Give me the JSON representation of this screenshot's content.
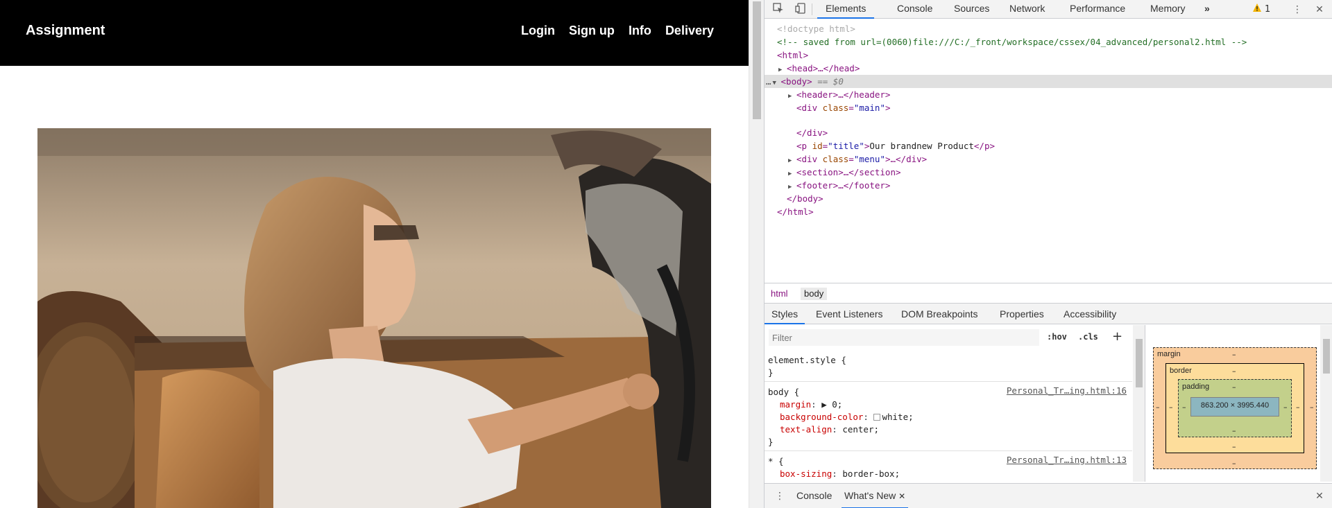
{
  "site": {
    "logo": "Assignment",
    "nav": [
      "Login",
      "Sign up",
      "Info",
      "Delivery"
    ]
  },
  "devtools": {
    "tabs": [
      "Elements",
      "Console",
      "Sources",
      "Network",
      "Performance",
      "Memory"
    ],
    "more_tabs": "»",
    "warning_count": "1",
    "dom": {
      "doctype": "<!doctype html>",
      "comment": "<!-- saved from url=(0060)file:///C:/_front/workspace/cssex/04_advanced/personal2.html -->",
      "html_open": "<html>",
      "head": "<head>…</head>",
      "body_open": "<body>",
      "body_marker": " == $0",
      "header": "<header>…</header>",
      "div_main_tag": "div",
      "div_main_attr": "class",
      "div_main_val": "\"main\"",
      "div_close": "</div>",
      "p_attr": "id",
      "p_val": "\"title\"",
      "p_text": "Our brandnew Product",
      "menu_attr": "class",
      "menu_val": "\"menu\"",
      "section": "<section>…</section>",
      "footer": "<footer>…</footer>",
      "body_close": "</body>",
      "html_close": "</html>"
    },
    "breadcrumbs": [
      "html",
      "body"
    ],
    "subtabs": [
      "Styles",
      "Event Listeners",
      "DOM Breakpoints",
      "Properties",
      "Accessibility"
    ],
    "filter_placeholder": "Filter",
    "hov": ":hov",
    "cls": ".cls",
    "rules": [
      {
        "selector": "element.style {",
        "close": "}"
      },
      {
        "selector": "body {",
        "source": "Personal_Tr…ing.html:16",
        "props": [
          {
            "name": "margin",
            "value": "▶ 0;"
          },
          {
            "name": "background-color",
            "value": "white;"
          },
          {
            "name": "text-align",
            "value": "center;"
          }
        ],
        "close": "}"
      },
      {
        "selector": "* {",
        "source": "Personal_Tr…ing.html:13",
        "props": [
          {
            "name": "box-sizing",
            "value": "border-box;"
          }
        ]
      }
    ],
    "box_model": {
      "margin_label": "margin",
      "border_label": "border",
      "padding_label": "padding",
      "content": "863.200 × 3995.440",
      "dash": "–"
    },
    "drawer_tabs": [
      "Console",
      "What's New"
    ]
  }
}
